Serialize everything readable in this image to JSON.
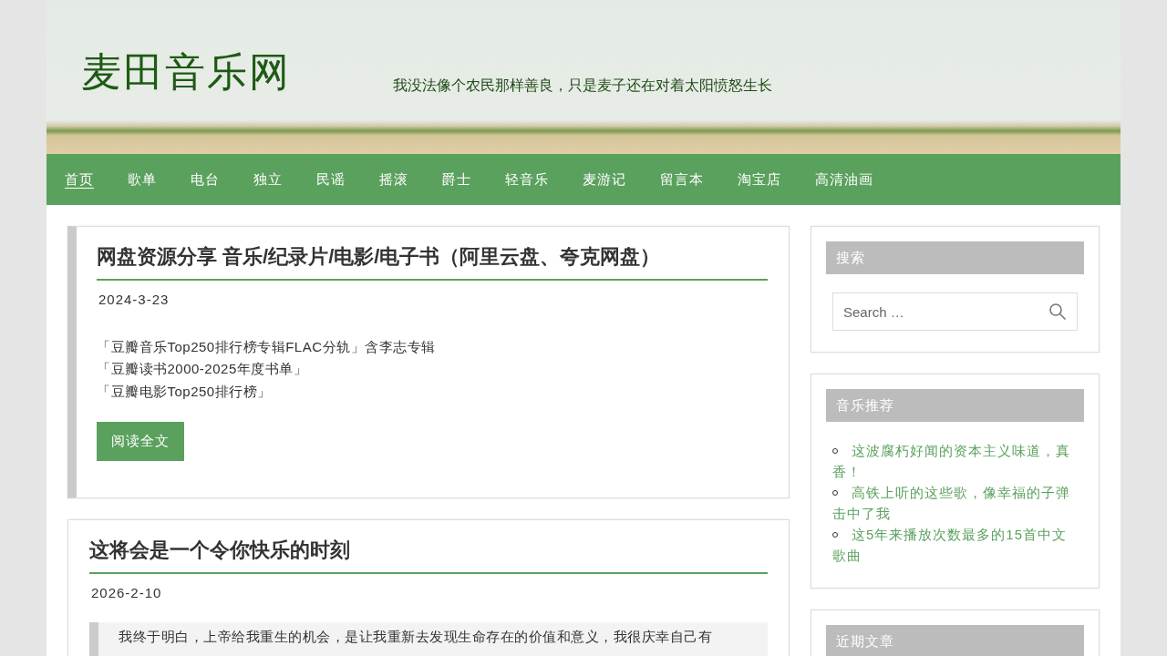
{
  "header": {
    "logo": "麦田音乐网",
    "slogan": "我没法像个农民那样善良，只是麦子还在对着太阳愤怒生长"
  },
  "nav": [
    {
      "label": "首页",
      "selected": true
    },
    {
      "label": "歌单",
      "selected": false
    },
    {
      "label": "电台",
      "selected": false
    },
    {
      "label": "独立",
      "selected": false
    },
    {
      "label": "民谣",
      "selected": false
    },
    {
      "label": "摇滚",
      "selected": false
    },
    {
      "label": "爵士",
      "selected": false
    },
    {
      "label": "轻音乐",
      "selected": false
    },
    {
      "label": "麦游记",
      "selected": false
    },
    {
      "label": "留言本",
      "selected": false
    },
    {
      "label": "淘宝店",
      "selected": false
    },
    {
      "label": "高清油画",
      "selected": false
    }
  ],
  "posts": [
    {
      "sticky": true,
      "title": "网盘资源分享 音乐/纪录片/电影/电子书（阿里云盘、夸克网盘）",
      "date": "2024-3-23",
      "lines": [
        "「豆瓣音乐Top250排行榜专辑FLAC分轨」含李志专辑",
        "「豆瓣读书2000-2025年度书单」",
        "「豆瓣电影Top250排行榜」"
      ],
      "button": "阅读全文"
    },
    {
      "sticky": false,
      "title": "这将会是一个令你快乐的时刻",
      "date": "2026-2-10",
      "quote": "我终于明白，上帝给我重生的机会，是让我重新去发现生命存在的价值和意义，我很庆幸自己有"
    }
  ],
  "sidebar": {
    "search": {
      "title": "搜索",
      "placeholder": "Search …"
    },
    "music": {
      "title": "音乐推荐",
      "links": [
        "这波腐朽好闻的资本主义味道，真香！",
        "高铁上听的这些歌，像幸福的子弹击中了我",
        "这5年来播放次数最多的15首中文歌曲"
      ]
    },
    "recent": {
      "title": "近期文章"
    }
  }
}
